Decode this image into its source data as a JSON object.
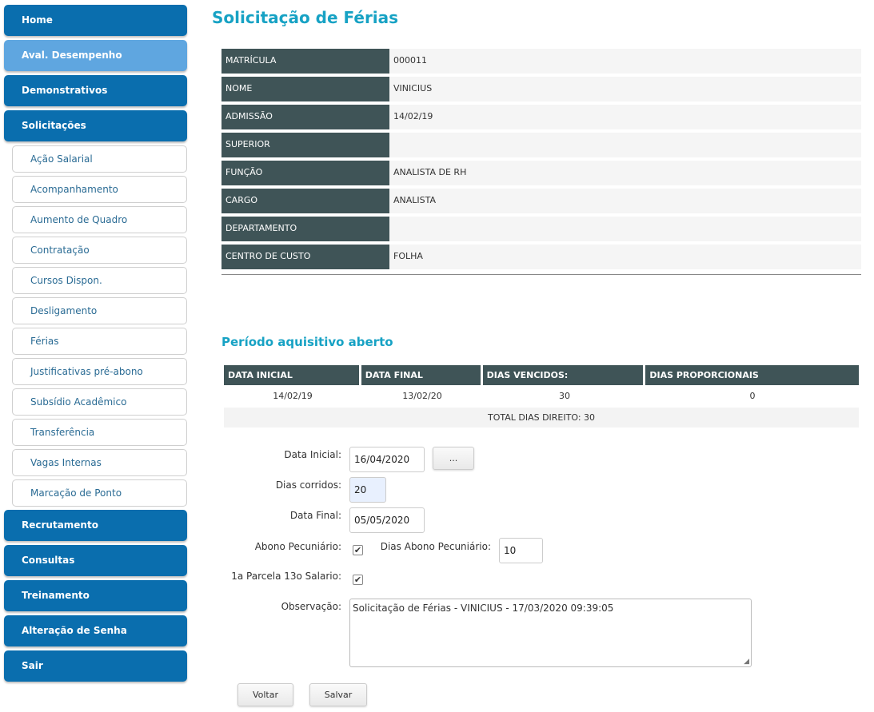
{
  "sidebar": {
    "menu_top": [
      {
        "label": "Home"
      },
      {
        "label": "Aval. Desempenho"
      },
      {
        "label": "Demonstrativos"
      },
      {
        "label": "Solicitações"
      }
    ],
    "submenu": [
      {
        "label": "Ação Salarial"
      },
      {
        "label": "Acompanhamento"
      },
      {
        "label": "Aumento de Quadro"
      },
      {
        "label": "Contratação"
      },
      {
        "label": "Cursos Dispon."
      },
      {
        "label": "Desligamento"
      },
      {
        "label": "Férias"
      },
      {
        "label": "Justificativas pré-abono"
      },
      {
        "label": "Subsídio Acadêmico"
      },
      {
        "label": "Transferência"
      },
      {
        "label": "Vagas Internas"
      },
      {
        "label": "Marcação de Ponto"
      }
    ],
    "menu_bottom": [
      {
        "label": "Recrutamento"
      },
      {
        "label": "Consultas"
      },
      {
        "label": "Treinamento"
      },
      {
        "label": "Alteração de Senha"
      },
      {
        "label": "Sair"
      }
    ]
  },
  "page": {
    "title": "Solicitação de Férias"
  },
  "employee": [
    {
      "label": "MATRÍCULA",
      "value": "000011"
    },
    {
      "label": "NOME",
      "value": "VINICIUS"
    },
    {
      "label": "ADMISSÃO",
      "value": "14/02/19"
    },
    {
      "label": "SUPERIOR",
      "value": ""
    },
    {
      "label": "FUNÇÃO",
      "value": "ANALISTA DE RH"
    },
    {
      "label": "CARGO",
      "value": "ANALISTA"
    },
    {
      "label": "DEPARTAMENTO",
      "value": ""
    },
    {
      "label": "CENTRO DE CUSTO",
      "value": "FOLHA"
    }
  ],
  "period": {
    "title": "Período aquisitivo aberto",
    "headers": [
      "DATA INICIAL",
      "DATA FINAL",
      "DIAS VENCIDOS:",
      "DIAS PROPORCIONAIS"
    ],
    "row": [
      "14/02/19",
      "13/02/20",
      "30",
      "0"
    ],
    "total": "TOTAL DIAS DIREITO: 30"
  },
  "form": {
    "data_inicial_label": "Data Inicial:",
    "data_inicial_value": "16/04/2020",
    "picker_label": "...",
    "dias_corridos_label": "Dias corridos:",
    "dias_corridos_value": "20",
    "data_final_label": "Data Final:",
    "data_final_value": "05/05/2020",
    "abono_label": "Abono Pecuniário:",
    "abono_checked": true,
    "dias_abono_label": "Dias Abono Pecuniário:",
    "dias_abono_value": "10",
    "parcela_label": "1a Parcela 13o Salario:",
    "parcela_checked": true,
    "obs_label": "Observação:",
    "obs_value": "Solicitação de Férias - VINICIUS - 17/03/2020 09:39:05",
    "voltar_label": "Voltar",
    "salvar_label": "Salvar"
  },
  "colors": {
    "menu_blue": "#0a6eae",
    "menu_active": "#5fa6e0",
    "title_teal": "#17a2c4",
    "header_dark": "#3f5457"
  }
}
